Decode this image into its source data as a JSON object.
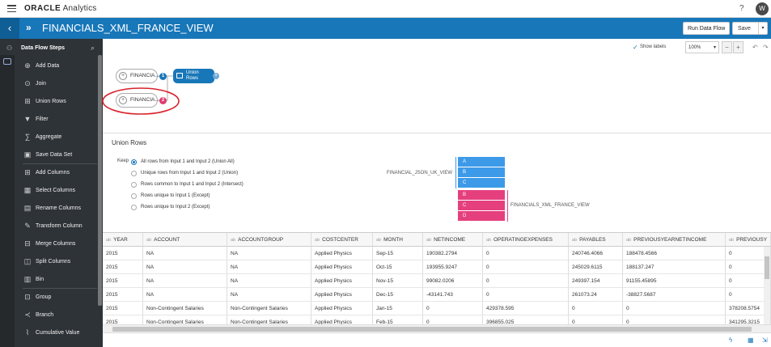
{
  "header": {
    "brand_strong": "ORACLE",
    "brand_rest": "Analytics",
    "help": "?",
    "avatar": "W"
  },
  "titlebar": {
    "back": "‹",
    "title": "FINANCIALS_XML_FRANCE_VIEW",
    "run_label": "Run Data Flow",
    "save_label": "Save"
  },
  "sidebar": {
    "title": "Data Flow Steps",
    "items": [
      {
        "label": "Add Data",
        "icon": "add-data-icon",
        "glyph": "⊕"
      },
      {
        "label": "Join",
        "icon": "join-icon",
        "glyph": "⊙"
      },
      {
        "label": "Union Rows",
        "icon": "union-rows-icon",
        "glyph": "⊞"
      },
      {
        "label": "Filter",
        "icon": "filter-icon",
        "glyph": "▼"
      },
      {
        "label": "Aggregate",
        "icon": "aggregate-icon",
        "glyph": "∑"
      },
      {
        "label": "Save Data Set",
        "icon": "save-data-set-icon",
        "glyph": "▣"
      },
      {
        "label": "Add Columns",
        "icon": "add-columns-icon",
        "glyph": "⊞"
      },
      {
        "label": "Select Columns",
        "icon": "select-columns-icon",
        "glyph": "▦"
      },
      {
        "label": "Rename Columns",
        "icon": "rename-columns-icon",
        "glyph": "▤"
      },
      {
        "label": "Transform Column",
        "icon": "transform-column-icon",
        "glyph": "✎"
      },
      {
        "label": "Merge Columns",
        "icon": "merge-columns-icon",
        "glyph": "⊟"
      },
      {
        "label": "Split Columns",
        "icon": "split-columns-icon",
        "glyph": "◫"
      },
      {
        "label": "Bin",
        "icon": "bin-icon",
        "glyph": "▥"
      },
      {
        "label": "Group",
        "icon": "group-icon",
        "glyph": "⊡"
      },
      {
        "label": "Branch",
        "icon": "branch-icon",
        "glyph": "≺"
      },
      {
        "label": "Cumulative Value",
        "icon": "cumulative-value-icon",
        "glyph": "⌇"
      }
    ]
  },
  "canvas": {
    "show_labels": "Show labels",
    "zoom": "100%",
    "nodes": [
      {
        "label": "FINANCIA...",
        "badge": "1"
      },
      {
        "label": "FINANCIA...",
        "badge": "2"
      }
    ],
    "union_label_1": "Union",
    "union_label_2": "Rows",
    "colors": {
      "badge1": "#1877b9",
      "badge2": "#e03a6f",
      "annotation": "#d9232d"
    }
  },
  "union_panel": {
    "title": "Union Rows",
    "keep_label": "Keep",
    "options": [
      {
        "label": "All rows from Input 1 and Input 2 (Union All)",
        "selected": true
      },
      {
        "label": "Unique rows from Input 1 and Input 2 (Union)",
        "selected": false
      },
      {
        "label": "Rows common to Input 1 and Input 2 (Intersect)",
        "selected": false
      },
      {
        "label": "Rows unique to Input 1 (Except)",
        "selected": false
      },
      {
        "label": "Rows unique to Input 2 (Except)",
        "selected": false
      }
    ],
    "input1_name": "FINANCIAL_JSON_UK_VIEW",
    "input1_rows": [
      "A",
      "B",
      "C"
    ],
    "input2_name": "FINANCIALS_XML_FRANCE_VIEW",
    "input2_rows": [
      "B",
      "C",
      "D"
    ]
  },
  "table": {
    "columns": [
      {
        "type": "ab",
        "name": "YEAR"
      },
      {
        "type": "ab",
        "name": "ACCOUNT"
      },
      {
        "type": "ab",
        "name": "ACCOUNTGROUP"
      },
      {
        "type": "ab",
        "name": "COSTCENTER"
      },
      {
        "type": "ab",
        "name": "MONTH"
      },
      {
        "type": "ab",
        "name": "NETINCOME"
      },
      {
        "type": "ab",
        "name": "OPERATINGEXPENSES"
      },
      {
        "type": "ab",
        "name": "PAYABLES"
      },
      {
        "type": "ab",
        "name": "PREVIOUSYEARNETINCOME"
      },
      {
        "type": "ab",
        "name": "PREVIOUSY"
      }
    ],
    "rows": [
      [
        "2015",
        "NA",
        "NA",
        "Applied Physics",
        "Sep-15",
        "190382.2794",
        "0",
        "240746.4066",
        "188478.4566",
        "0"
      ],
      [
        "2015",
        "NA",
        "NA",
        "Applied Physics",
        "Oct-15",
        "193955.9247",
        "0",
        "245029.6115",
        "188137.247",
        "0"
      ],
      [
        "2015",
        "NA",
        "NA",
        "Applied Physics",
        "Nov-15",
        "99082.0206",
        "0",
        "249397.154",
        "91155.45895",
        "0"
      ],
      [
        "2015",
        "NA",
        "NA",
        "Applied Physics",
        "Dec-15",
        "-43141.743",
        "0",
        "261073.24",
        "-38827.5687",
        "0"
      ],
      [
        "2015",
        "Non-Contingent Salaries",
        "Non-Contingent Salaries",
        "Applied Physics",
        "Jan-15",
        "0",
        "429378.595",
        "0",
        "0",
        "378208.5754"
      ],
      [
        "2015",
        "Non-Contingent Salaries",
        "Non-Contingent Salaries",
        "Applied Physics",
        "Feb-15",
        "0",
        "396855.025",
        "0",
        "0",
        "341295.3215"
      ]
    ]
  }
}
